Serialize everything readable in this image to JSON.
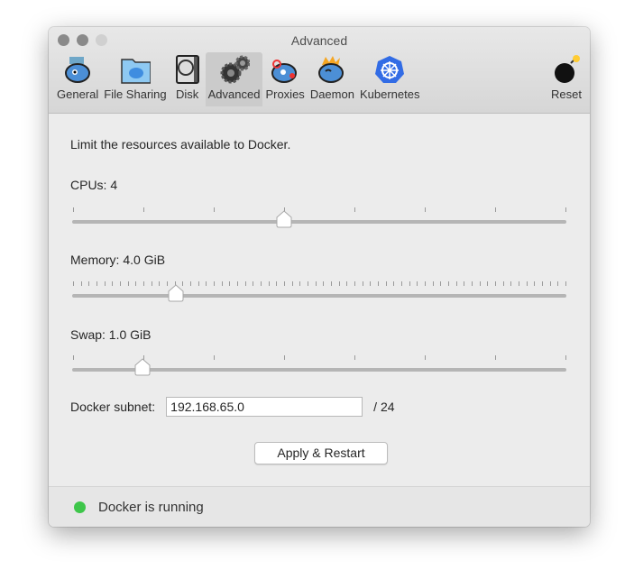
{
  "window": {
    "title": "Advanced"
  },
  "toolbar": {
    "items": [
      {
        "label": "General",
        "icon": "docker-whale-icon"
      },
      {
        "label": "File Sharing",
        "icon": "folder-icon"
      },
      {
        "label": "Disk",
        "icon": "disk-icon"
      },
      {
        "label": "Advanced",
        "icon": "gears-icon",
        "active": true
      },
      {
        "label": "Proxies",
        "icon": "whale-proxies-icon"
      },
      {
        "label": "Daemon",
        "icon": "whale-daemon-icon"
      },
      {
        "label": "Kubernetes",
        "icon": "kubernetes-icon"
      }
    ],
    "reset": {
      "label": "Reset",
      "icon": "bomb-icon"
    }
  },
  "main": {
    "intro": "Limit the resources available to Docker.",
    "cpus": {
      "label": "CPUs: 4",
      "value": 4,
      "min": 1,
      "max": 8,
      "ticks": 8
    },
    "memory": {
      "label": "Memory: 4.0 GiB",
      "fraction": 0.21,
      "ticks": 64
    },
    "swap": {
      "label": "Swap: 1.0 GiB",
      "value": 1,
      "ticks": 8,
      "fraction": 0.143
    },
    "subnet": {
      "label": "Docker subnet:",
      "value": "192.168.65.0",
      "suffix": "/ 24"
    },
    "apply_label": "Apply & Restart"
  },
  "status": {
    "text": "Docker is running",
    "color": "#3ec64a"
  }
}
